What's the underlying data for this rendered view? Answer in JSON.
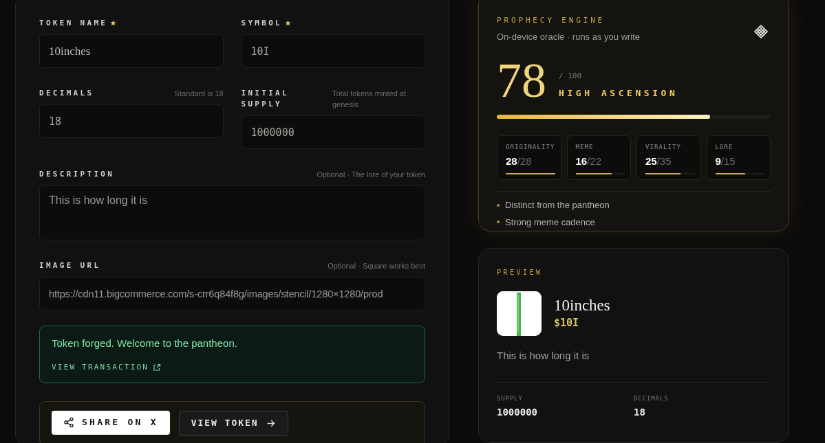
{
  "form": {
    "fields": [
      {
        "label": "TOKEN NAME",
        "required": true,
        "value": "10inches",
        "kind": "serif"
      },
      {
        "label": "SYMBOL",
        "required": true,
        "value": "10I",
        "kind": "mono"
      },
      {
        "label": "DECIMALS",
        "hint": "Standard is 18",
        "value": "18",
        "kind": "mono"
      },
      {
        "label": "INITIAL SUPPLY",
        "hint": "Total tokens minted at genesis",
        "value": "1000000",
        "kind": "mono"
      },
      {
        "label": "DESCRIPTION",
        "hint": "Optional · The lore of your token",
        "value": "This is how long it is",
        "kind": "textarea"
      },
      {
        "label": "IMAGE URL",
        "hint": "Optional · Square works best",
        "value": "https://cdn11.bigcommerce.com/s-crr6q84f8g/images/stencil/1280×1280/prod",
        "kind": "sans"
      }
    ],
    "success": {
      "message": "Token forged. Welcome to the pantheon.",
      "link": "VIEW TRANSACTION"
    },
    "actions": [
      {
        "label": "SHARE ON X",
        "kind": "primary"
      },
      {
        "label": "VIEW TOKEN",
        "kind": "secondary"
      }
    ]
  },
  "prophecy": {
    "title": "PROPHECY ENGINE",
    "subtitle": "On-device oracle · runs as you write",
    "score": "78",
    "out_of": "/ 100",
    "verdict": "HIGH ASCENSION",
    "level": 0.78,
    "metrics": [
      {
        "label": "ORIGINALITY",
        "value": "28",
        "max": "/28",
        "level": 1
      },
      {
        "label": "MEME",
        "value": "16",
        "max": "/22",
        "level": 0.73
      },
      {
        "label": "VIRALITY",
        "value": "25",
        "max": "/35",
        "level": 0.71
      },
      {
        "label": "LORE",
        "value": "9",
        "max": "/15",
        "level": 0.6
      }
    ],
    "notes": [
      "Distinct from the pantheon",
      "Strong meme cadence"
    ]
  },
  "preview": {
    "title": "PREVIEW",
    "name": "10inches",
    "symbol": "$10I",
    "description": "This is how long it is",
    "stats": [
      {
        "label": "SUPPLY",
        "value": "1000000"
      },
      {
        "label": "DECIMALS",
        "value": "18"
      }
    ]
  }
}
